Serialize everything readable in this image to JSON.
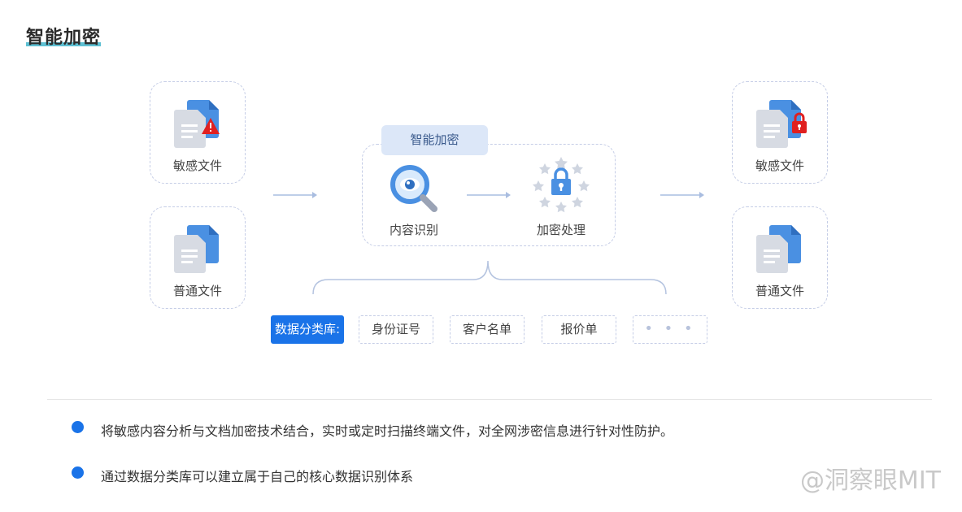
{
  "title": "智能加密",
  "left_files": [
    {
      "label": "敏感文件",
      "badge": "warning-icon"
    },
    {
      "label": "普通文件",
      "badge": ""
    }
  ],
  "right_files": [
    {
      "label": "敏感文件",
      "badge": "lock-icon"
    },
    {
      "label": "普通文件",
      "badge": ""
    }
  ],
  "process": {
    "tab_label": "智能加密",
    "step1_label": "内容识别",
    "step2_label": "加密处理"
  },
  "database": {
    "label": "数据分类库:",
    "items": [
      "身份证号",
      "客户名单",
      "报价单",
      "• • •"
    ]
  },
  "bullets": [
    "将敏感内容分析与文档加密技术结合，实时或定时扫描终端文件，对全网涉密信息进行针对性防护。",
    "通过数据分类库可以建立属于自己的核心数据识别体系"
  ],
  "watermark": "@洞察眼MIT",
  "colors": {
    "accent": "#1a73e8",
    "doc_blue": "#4a90e2",
    "doc_gray": "#d7dbe3",
    "warning_red": "#e02020",
    "border_dashed": "#c5cde6"
  }
}
